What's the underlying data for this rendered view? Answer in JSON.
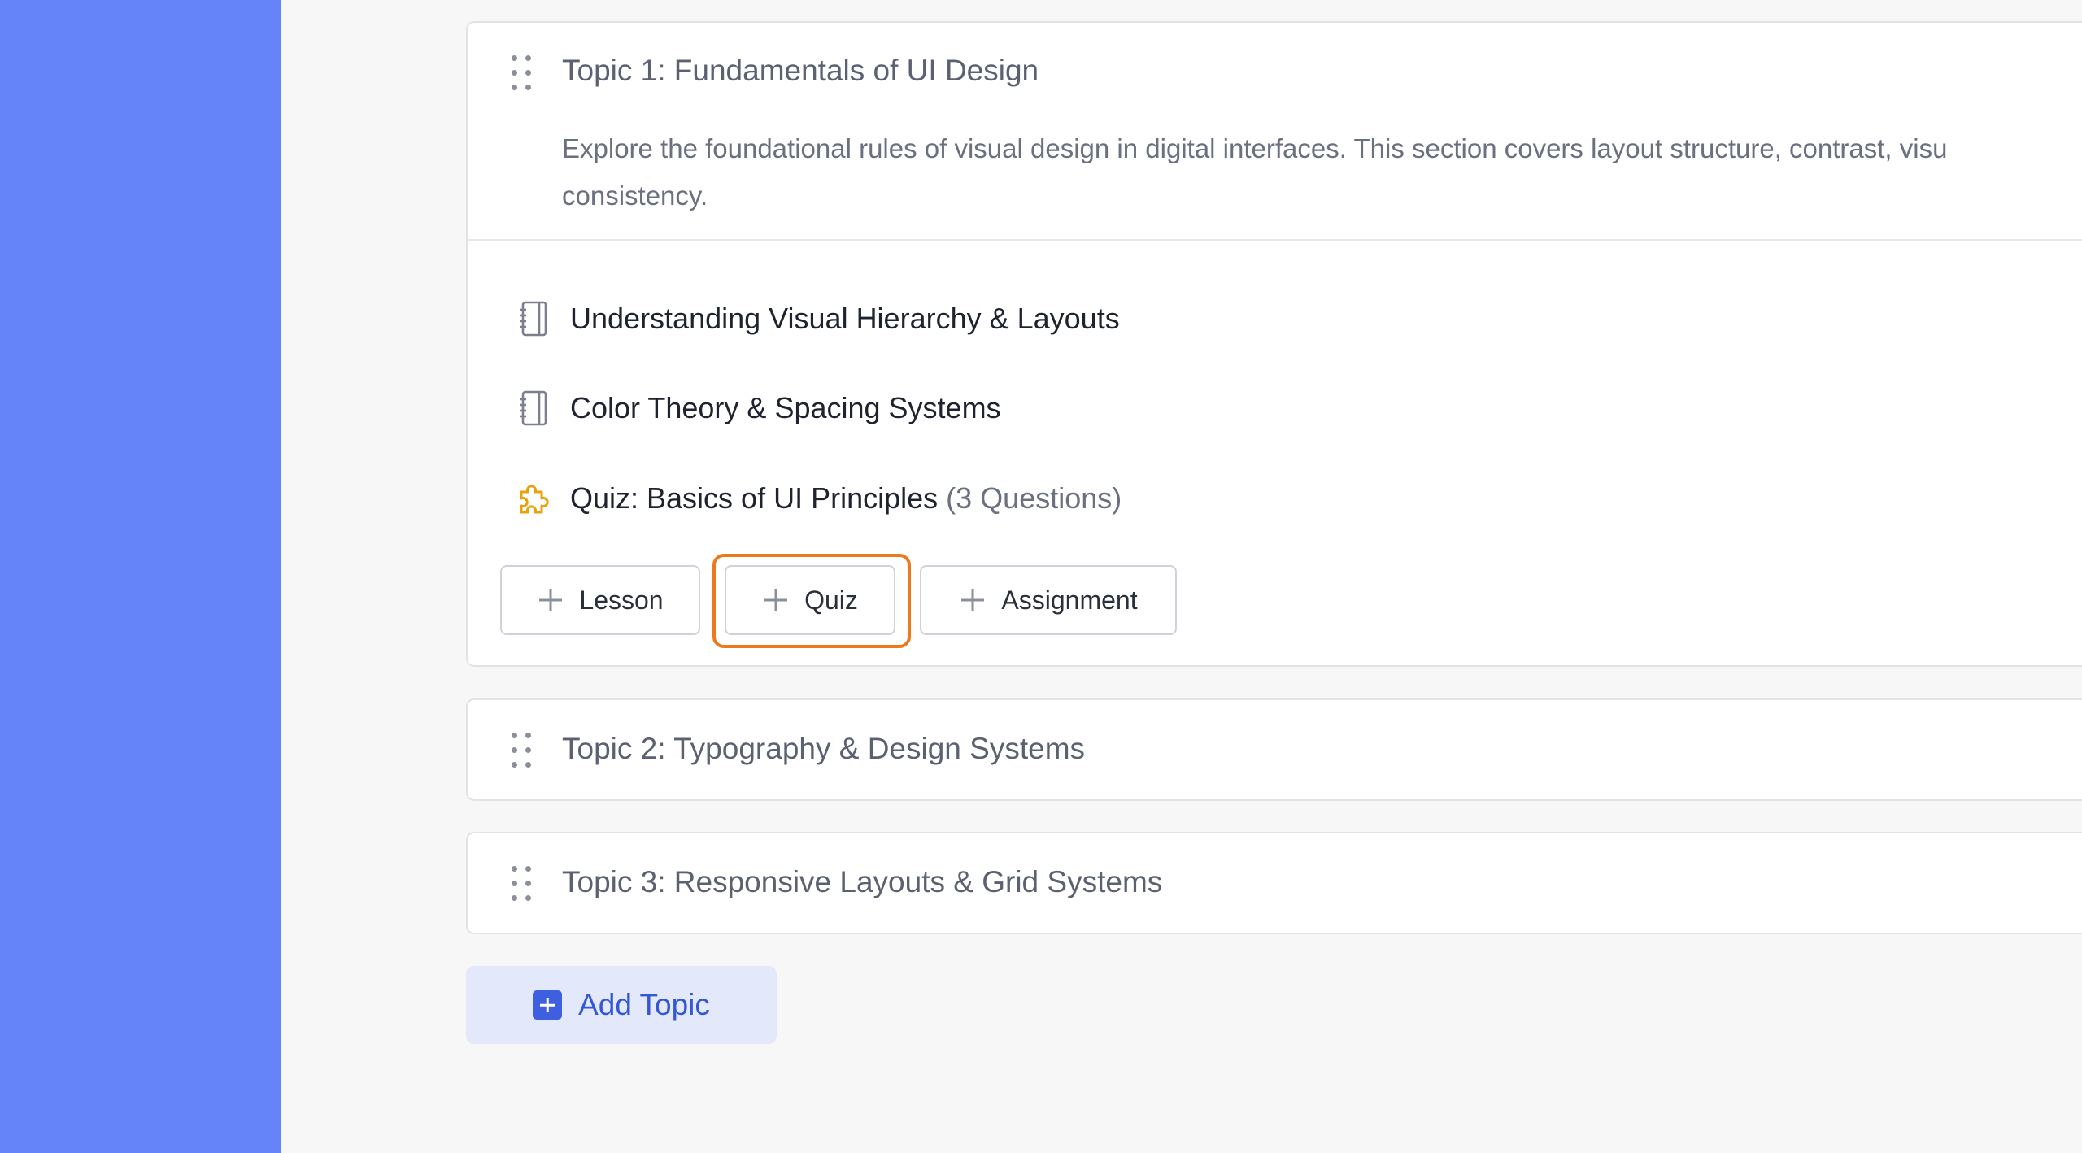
{
  "colors": {
    "sidebar": "#6584fa",
    "highlight": "#ec7a1c",
    "quiz_icon": "#e8a20c",
    "add_topic_bg": "#e3e8fb",
    "add_topic_text": "#3358d4"
  },
  "topics": [
    {
      "title": "Topic 1: Fundamentals of UI Design",
      "description": "Explore the foundational rules of visual design in digital interfaces. This section covers layout structure, contrast, visu\nconsistency.",
      "expanded": true,
      "items": [
        {
          "type": "lesson",
          "icon": "lesson-book-icon",
          "label": "Understanding Visual Hierarchy & Layouts"
        },
        {
          "type": "lesson",
          "icon": "lesson-book-icon",
          "label": "Color Theory & Spacing Systems"
        },
        {
          "type": "quiz",
          "icon": "quiz-puzzle-icon",
          "label": "Quiz: Basics of UI Principles",
          "extra": "(3 Questions)"
        }
      ],
      "actions": {
        "lesson": "Lesson",
        "quiz": "Quiz",
        "assignment": "Assignment"
      }
    },
    {
      "title": "Topic 2: Typography & Design Systems",
      "expanded": false
    },
    {
      "title": "Topic 3: Responsive Layouts & Grid Systems",
      "expanded": false
    }
  ],
  "add_topic_label": "Add Topic"
}
